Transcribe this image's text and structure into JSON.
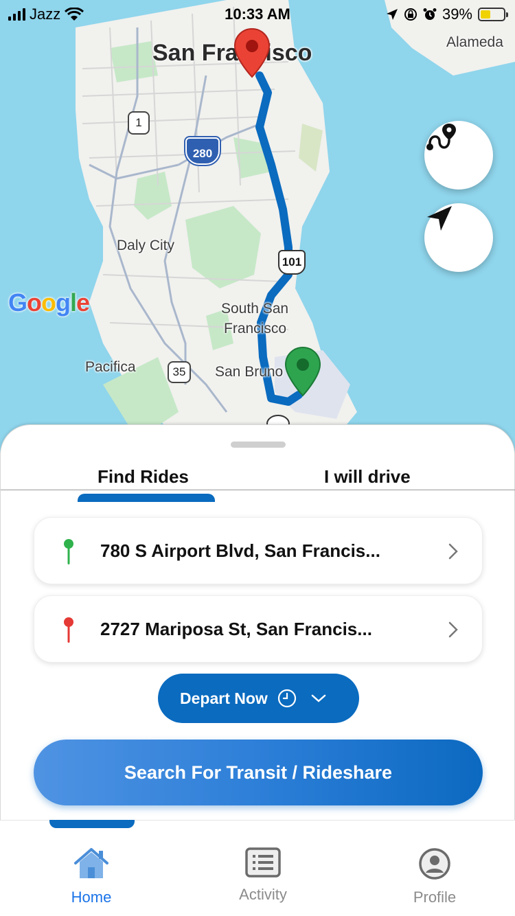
{
  "status_bar": {
    "carrier": "Jazz",
    "time": "10:33 AM",
    "battery": "39%"
  },
  "map": {
    "labels": {
      "san_francisco": "San Francisco",
      "alameda": "Alameda",
      "daly_city": "Daly City",
      "south_sf_line1": "South San",
      "south_sf_line2": "Francisco",
      "pacifica": "Pacifica",
      "san_bruno": "San Bruno"
    },
    "shields": {
      "hwy1": "1",
      "i280": "280",
      "us101": "101",
      "hwy35": "35"
    },
    "attribution": "Google",
    "colors": {
      "water": "#8fd5ec",
      "land": "#f1f1ee",
      "park": "#c6e8c7",
      "route": "#0a6bbf"
    }
  },
  "sheet": {
    "tabs": [
      {
        "label": "Find Rides",
        "active": true
      },
      {
        "label": "I will drive",
        "active": false
      }
    ],
    "origin": {
      "address": "780 S Airport Blvd, San Francis...",
      "pin_color": "#2fb24c"
    },
    "destination": {
      "address": "2727 Mariposa St, San Francis...",
      "pin_color": "#e53935"
    },
    "depart_label": "Depart Now",
    "search_label": "Search For Transit / Rideshare"
  },
  "bottom_nav": {
    "items": [
      {
        "label": "Home",
        "active": true
      },
      {
        "label": "Activity",
        "active": false
      },
      {
        "label": "Profile",
        "active": false
      }
    ]
  }
}
